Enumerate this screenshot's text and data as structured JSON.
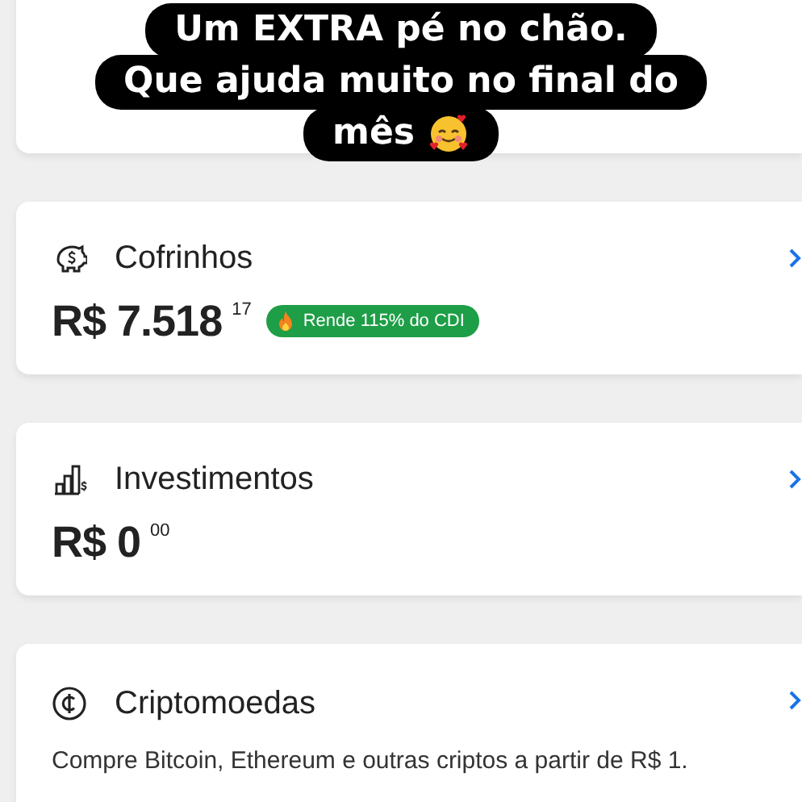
{
  "caption": {
    "lines": [
      "Um EXTRA pé no chão.",
      "Que ajuda muito no final do",
      "mês"
    ]
  },
  "cards": [
    {
      "kind": "blank"
    },
    {
      "kind": "balance",
      "title": "Cofrinhos",
      "amount": "R$ 7.518",
      "cents": "17",
      "badge": "Rende 115% do CDI"
    },
    {
      "kind": "balance",
      "title": "Investimentos",
      "amount": "R$ 0",
      "cents": "00"
    },
    {
      "kind": "info",
      "title": "Criptomoedas",
      "text": "Compre Bitcoin, Ethereum e outras criptos a partir de R$ 1."
    }
  ]
}
